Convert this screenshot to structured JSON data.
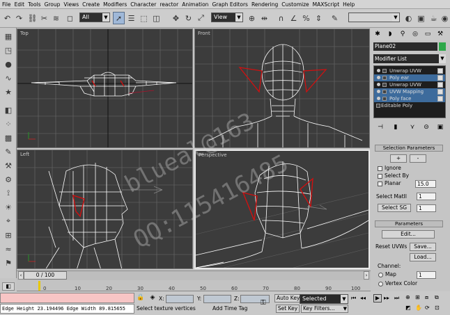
{
  "menu": [
    "File",
    "Edit",
    "Tools",
    "Group",
    "Views",
    "Create",
    "Modifiers",
    "Character",
    "reactor",
    "Animation",
    "Graph Editors",
    "Rendering",
    "Customize",
    "MAXScript",
    "Help"
  ],
  "toolbar": {
    "selection_filter": "All",
    "ref_coord": "View"
  },
  "viewports": {
    "top": "Top",
    "front": "Front",
    "left": "Left",
    "perspective": "Perspective"
  },
  "command_panel": {
    "object_name": "Plane02",
    "object_color": "#2ea84a",
    "modifier_list": "Modifier List",
    "stack": [
      "Unwrap UVW",
      "Poly ear",
      "Unwrap UVW",
      "UVW Mapping",
      "Poly face",
      "Editable Poly"
    ],
    "selection_params_title": "Selection Parameters",
    "plus": "+",
    "minus": "-",
    "ignore": "Ignore",
    "select_by": "Select By",
    "planar": "Planar",
    "planar_value": "15.0",
    "select_matid": "Select MatII",
    "select_matid_value": "1",
    "select_sg": "Select SG",
    "select_sg_value": "1",
    "params_title": "Parameters",
    "edit": "Edit...",
    "reset_uvws": "Reset UVWs",
    "save": "Save...",
    "load": "Load...",
    "channel": "Channel:",
    "map": "Map",
    "map_value": "1",
    "vertex_color": "Vertex Color"
  },
  "timeline": {
    "frame": "0 / 100",
    "ticks": [
      "0",
      "10",
      "20",
      "30",
      "40",
      "50",
      "60",
      "70",
      "80",
      "90",
      "100"
    ]
  },
  "status": {
    "status_text": "Edge Height 23.194496 Edge Width 89.815655",
    "prompt": "Select texture vertices",
    "add_time_tag": "Add Time Tag",
    "x_label": "X:",
    "y_label": "Y:",
    "z_label": "Z:",
    "auto_key": "Auto Key",
    "selected": "Selected",
    "set_key": "Set Key",
    "key_filters": "Key Filters..."
  },
  "watermark": [
    "blueal@163",
    "QQ:115416485"
  ]
}
